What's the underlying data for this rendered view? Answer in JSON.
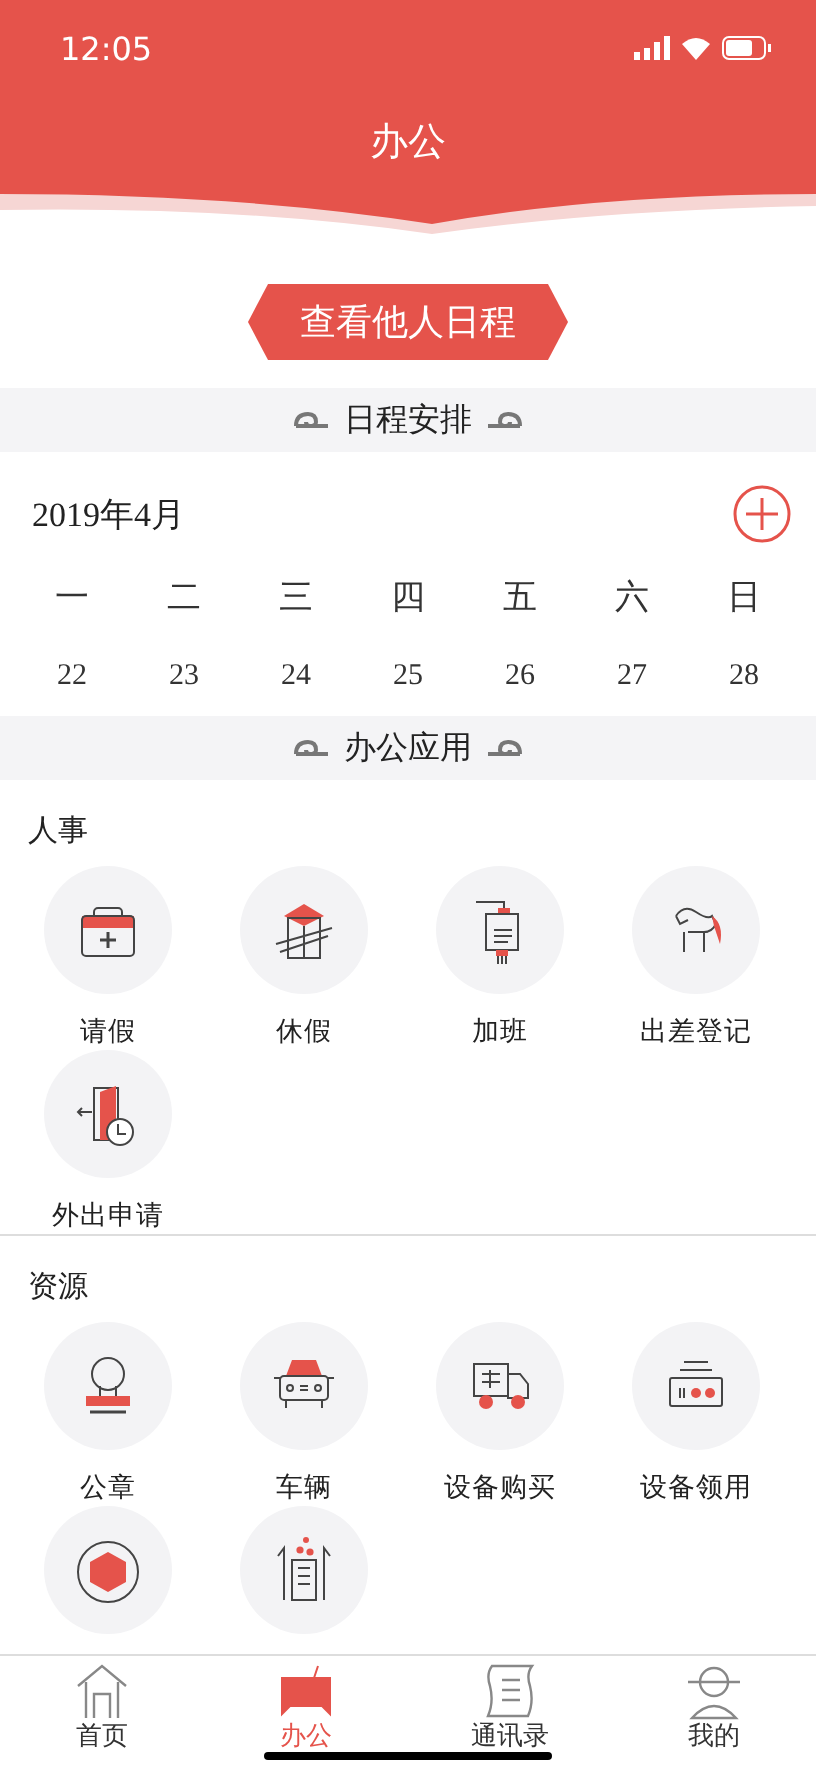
{
  "status_bar": {
    "time": "12:05"
  },
  "header": {
    "title": "办公"
  },
  "others_schedule_button": {
    "label": "查看他人日程"
  },
  "schedule_section": {
    "title": "日程安排"
  },
  "calendar": {
    "month": "2019年4月",
    "weekdays": [
      "一",
      "二",
      "三",
      "四",
      "五",
      "六",
      "日"
    ],
    "dates": [
      "22",
      "23",
      "24",
      "25",
      "26",
      "27",
      "28"
    ]
  },
  "apps_section": {
    "title": "办公应用"
  },
  "groups": [
    {
      "title": "人事",
      "items": [
        {
          "kind": "leave",
          "label": "请假"
        },
        {
          "kind": "vacation",
          "label": "休假"
        },
        {
          "kind": "overtime",
          "label": "加班"
        },
        {
          "kind": "trip",
          "label": "出差登记"
        },
        {
          "kind": "outing",
          "label": "外出申请"
        }
      ]
    },
    {
      "title": "资源",
      "items": [
        {
          "kind": "seal",
          "label": "公章"
        },
        {
          "kind": "car",
          "label": "车辆"
        },
        {
          "kind": "purchase",
          "label": "设备购买"
        },
        {
          "kind": "device",
          "label": "设备领用"
        },
        {
          "kind": "hexagon"
        },
        {
          "kind": "cabinet"
        }
      ]
    }
  ],
  "tab_bar": [
    {
      "label": "首页",
      "selected": false
    },
    {
      "label": "办公",
      "selected": true
    },
    {
      "label": "通讯录",
      "selected": false
    },
    {
      "label": "我的",
      "selected": false
    }
  ]
}
